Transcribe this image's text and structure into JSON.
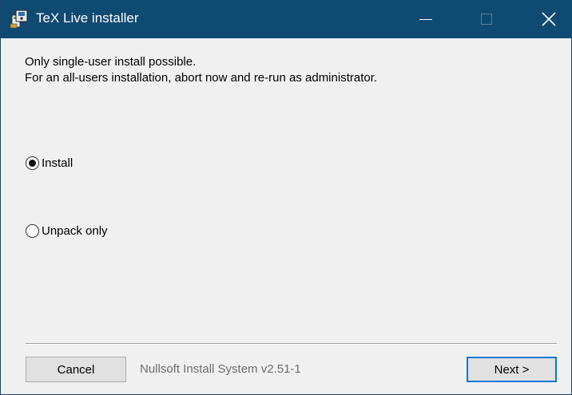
{
  "window": {
    "title": "TeX Live installer",
    "icon": "installer-icon",
    "controls": {
      "minimize": "minimize-icon",
      "maximize": "maximize-icon",
      "close": "close-icon"
    }
  },
  "message": {
    "line1": "Only single-user install possible.",
    "line2": "For an all-users installation, abort now and re-run as administrator."
  },
  "options": [
    {
      "label": "Install",
      "selected": true
    },
    {
      "label": "Unpack only",
      "selected": false
    }
  ],
  "footer": {
    "cancel_label": "Cancel",
    "branding": "Nullsoft Install System v2.51-1",
    "next_label": "Next >"
  },
  "colors": {
    "titlebar": "#0f4a73",
    "focus_border": "#0078d7",
    "background": "#f0f0f0"
  }
}
